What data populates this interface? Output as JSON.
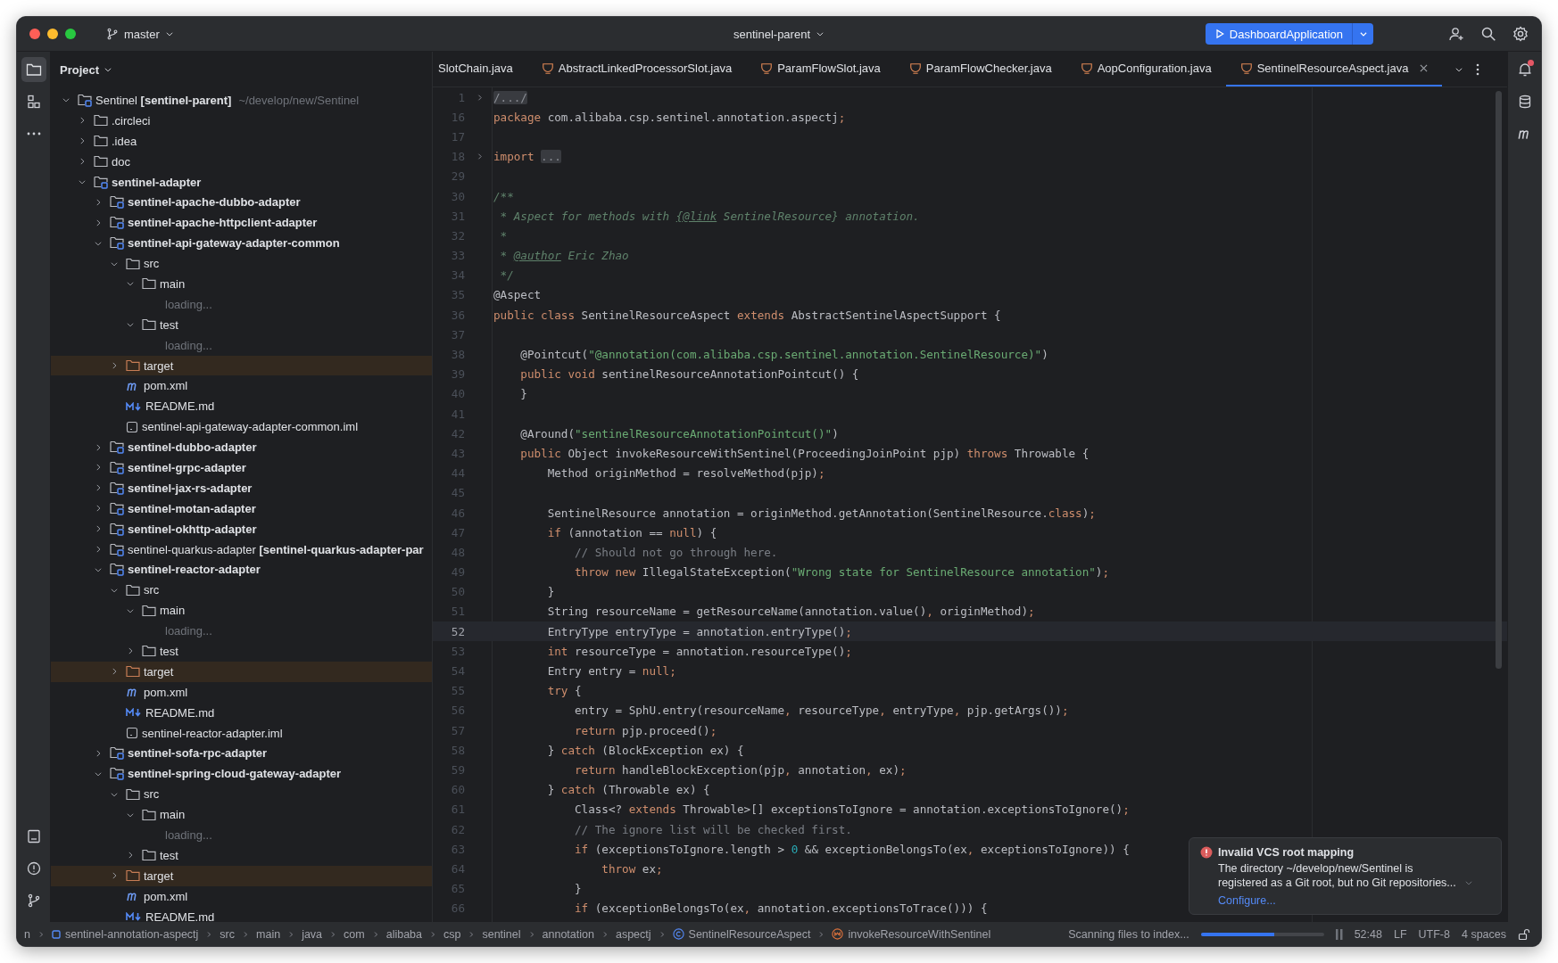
{
  "titlebar": {
    "branch": "master",
    "project": "sentinel-parent",
    "run_config": "DashboardApplication"
  },
  "project": {
    "title": "Project",
    "tree": [
      {
        "name": "Sentinel **[sentinel-parent]**",
        "path": "~/develop/new/Sentinel",
        "kind": "module",
        "expanded": true,
        "children": [
          {
            "name": ".circleci",
            "kind": "folder",
            "expanded": false
          },
          {
            "name": ".idea",
            "kind": "folder",
            "expanded": false
          },
          {
            "name": "doc",
            "kind": "folder",
            "expanded": false
          },
          {
            "name": "sentinel-adapter",
            "kind": "module",
            "bold": true,
            "expanded": true,
            "children": [
              {
                "name": "sentinel-apache-dubbo-adapter",
                "kind": "module",
                "bold": true,
                "expanded": false
              },
              {
                "name": "sentinel-apache-httpclient-adapter",
                "kind": "module",
                "bold": true,
                "expanded": false
              },
              {
                "name": "sentinel-api-gateway-adapter-common",
                "kind": "module",
                "bold": true,
                "expanded": true,
                "children": [
                  {
                    "name": "src",
                    "kind": "folder",
                    "expanded": true,
                    "children": [
                      {
                        "name": "main",
                        "kind": "folder",
                        "expanded": true,
                        "children": [
                          {
                            "name": "loading...",
                            "kind": "loading"
                          }
                        ]
                      },
                      {
                        "name": "test",
                        "kind": "folder",
                        "expanded": true,
                        "children": [
                          {
                            "name": "loading...",
                            "kind": "loading"
                          }
                        ]
                      }
                    ]
                  },
                  {
                    "name": "target",
                    "kind": "excluded",
                    "expanded": false
                  },
                  {
                    "name": "pom.xml",
                    "kind": "maven"
                  },
                  {
                    "name": "README.md",
                    "kind": "markdown"
                  },
                  {
                    "name": "sentinel-api-gateway-adapter-common.iml",
                    "kind": "iml"
                  }
                ]
              },
              {
                "name": "sentinel-dubbo-adapter",
                "kind": "module",
                "bold": true,
                "expanded": false
              },
              {
                "name": "sentinel-grpc-adapter",
                "kind": "module",
                "bold": true,
                "expanded": false
              },
              {
                "name": "sentinel-jax-rs-adapter",
                "kind": "module",
                "bold": true,
                "expanded": false
              },
              {
                "name": "sentinel-motan-adapter",
                "kind": "module",
                "bold": true,
                "expanded": false
              },
              {
                "name": "sentinel-okhttp-adapter",
                "kind": "module",
                "bold": true,
                "expanded": false
              },
              {
                "name": "sentinel-quarkus-adapter **[sentinel-quarkus-adapter-par**",
                "kind": "module",
                "expanded": false
              },
              {
                "name": "sentinel-reactor-adapter",
                "kind": "module",
                "bold": true,
                "expanded": true,
                "children": [
                  {
                    "name": "src",
                    "kind": "folder",
                    "expanded": true,
                    "children": [
                      {
                        "name": "main",
                        "kind": "folder",
                        "expanded": true,
                        "children": [
                          {
                            "name": "loading...",
                            "kind": "loading"
                          }
                        ]
                      },
                      {
                        "name": "test",
                        "kind": "folder",
                        "expanded": false
                      }
                    ]
                  },
                  {
                    "name": "target",
                    "kind": "excluded",
                    "expanded": false
                  },
                  {
                    "name": "pom.xml",
                    "kind": "maven"
                  },
                  {
                    "name": "README.md",
                    "kind": "markdown"
                  },
                  {
                    "name": "sentinel-reactor-adapter.iml",
                    "kind": "iml"
                  }
                ]
              },
              {
                "name": "sentinel-sofa-rpc-adapter",
                "kind": "module",
                "bold": true,
                "expanded": false
              },
              {
                "name": "sentinel-spring-cloud-gateway-adapter",
                "kind": "module",
                "bold": true,
                "expanded": true,
                "children": [
                  {
                    "name": "src",
                    "kind": "folder",
                    "expanded": true,
                    "children": [
                      {
                        "name": "main",
                        "kind": "folder",
                        "expanded": true,
                        "children": [
                          {
                            "name": "loading...",
                            "kind": "loading"
                          }
                        ]
                      },
                      {
                        "name": "test",
                        "kind": "folder",
                        "expanded": false
                      }
                    ]
                  },
                  {
                    "name": "target",
                    "kind": "excluded",
                    "expanded": false
                  },
                  {
                    "name": "pom.xml",
                    "kind": "maven"
                  },
                  {
                    "name": "README.md",
                    "kind": "markdown"
                  }
                ]
              }
            ]
          }
        ]
      }
    ]
  },
  "tabs": [
    {
      "label": "SlotChain.java",
      "kind": "plain",
      "selected": false
    },
    {
      "label": "AbstractLinkedProcessorSlot.java",
      "kind": "java",
      "selected": false
    },
    {
      "label": "ParamFlowSlot.java",
      "kind": "java",
      "selected": false
    },
    {
      "label": "ParamFlowChecker.java",
      "kind": "java",
      "selected": false
    },
    {
      "label": "AopConfiguration.java",
      "kind": "java",
      "selected": false
    },
    {
      "label": "SentinelResourceAspect.java",
      "kind": "java",
      "selected": true
    }
  ],
  "editor": {
    "lines": [
      {
        "no": "1",
        "folded": true,
        "tokens": [
          {
            "text": "/.../",
            "kind": "folded"
          }
        ]
      },
      {
        "no": "16",
        "tokens": [
          {
            "text": "package",
            "kind": "keyword"
          },
          {
            "text": " com.alibaba.csp.sentinel.annotation.aspectj",
            "kind": "plain"
          },
          {
            "text": ";",
            "kind": "keyword"
          }
        ]
      },
      {
        "no": "17"
      },
      {
        "no": "18",
        "folded": true,
        "tokens": [
          {
            "text": "import ",
            "kind": "keyword"
          },
          {
            "text": "...",
            "kind": "folded"
          }
        ]
      },
      {
        "no": "29"
      },
      {
        "no": "30",
        "tokens": [
          {
            "text": "/**",
            "kind": "doc"
          }
        ]
      },
      {
        "no": "31",
        "tokens": [
          {
            "text": " * Aspect for methods with ",
            "kind": "doc"
          },
          {
            "text": "{@link",
            "kind": "doctag"
          },
          {
            "text": " SentinelResource} annotation.",
            "kind": "doc"
          }
        ]
      },
      {
        "no": "32",
        "tokens": [
          {
            "text": " *",
            "kind": "doc"
          }
        ]
      },
      {
        "no": "33",
        "tokens": [
          {
            "text": " * ",
            "kind": "doc"
          },
          {
            "text": "@author",
            "kind": "doctag"
          },
          {
            "text": " Eric Zhao",
            "kind": "doc"
          }
        ]
      },
      {
        "no": "34",
        "tokens": [
          {
            "text": " */",
            "kind": "doc"
          }
        ]
      },
      {
        "no": "35",
        "tokens": [
          {
            "text": "@Aspect",
            "kind": "plain"
          }
        ]
      },
      {
        "no": "36",
        "tokens": [
          {
            "text": "public class",
            "kind": "keyword"
          },
          {
            "text": " SentinelResourceAspect ",
            "kind": "plain"
          },
          {
            "text": "extends",
            "kind": "keyword"
          },
          {
            "text": " AbstractSentinelAspectSupport {",
            "kind": "plain"
          }
        ]
      },
      {
        "no": "37"
      },
      {
        "no": "38",
        "tokens": [
          {
            "text": "    @Pointcut(",
            "kind": "plain"
          },
          {
            "text": "\"@annotation(com.alibaba.csp.sentinel.annotation.SentinelResource)\"",
            "kind": "string"
          },
          {
            "text": ")",
            "kind": "plain"
          }
        ]
      },
      {
        "no": "39",
        "tokens": [
          {
            "text": "    public void",
            "kind": "keyword"
          },
          {
            "text": " sentinelResourceAnnotationPointcut() {",
            "kind": "plain"
          }
        ]
      },
      {
        "no": "40",
        "tokens": [
          {
            "text": "    }",
            "kind": "plain"
          }
        ]
      },
      {
        "no": "41"
      },
      {
        "no": "42",
        "tokens": [
          {
            "text": "    @Around(",
            "kind": "plain"
          },
          {
            "text": "\"sentinelResourceAnnotationPointcut()\"",
            "kind": "string"
          },
          {
            "text": ")",
            "kind": "plain"
          }
        ]
      },
      {
        "no": "43",
        "tokens": [
          {
            "text": "    public",
            "kind": "keyword"
          },
          {
            "text": " Object invokeResourceWithSentinel(ProceedingJoinPoint pjp) ",
            "kind": "plain"
          },
          {
            "text": "throws",
            "kind": "keyword"
          },
          {
            "text": " Throwable {",
            "kind": "plain"
          }
        ]
      },
      {
        "no": "44",
        "tokens": [
          {
            "text": "        Method originMethod = resolveMethod(pjp)",
            "kind": "plain"
          },
          {
            "text": ";",
            "kind": "keyword"
          }
        ]
      },
      {
        "no": "45"
      },
      {
        "no": "46",
        "tokens": [
          {
            "text": "        SentinelResource annotation = originMethod.getAnnotation(SentinelResource.",
            "kind": "plain"
          },
          {
            "text": "class",
            "kind": "keyword"
          },
          {
            "text": ")",
            "kind": "plain"
          },
          {
            "text": ";",
            "kind": "keyword"
          }
        ]
      },
      {
        "no": "47",
        "tokens": [
          {
            "text": "        if",
            "kind": "keyword"
          },
          {
            "text": " (annotation == ",
            "kind": "plain"
          },
          {
            "text": "null",
            "kind": "keyword"
          },
          {
            "text": ") {",
            "kind": "plain"
          }
        ]
      },
      {
        "no": "48",
        "tokens": [
          {
            "text": "            // Should not go through here.",
            "kind": "comment"
          }
        ]
      },
      {
        "no": "49",
        "tokens": [
          {
            "text": "            throw new",
            "kind": "keyword"
          },
          {
            "text": " IllegalStateException(",
            "kind": "plain"
          },
          {
            "text": "\"Wrong state for SentinelResource annotation\"",
            "kind": "string"
          },
          {
            "text": ")",
            "kind": "plain"
          },
          {
            "text": ";",
            "kind": "keyword"
          }
        ]
      },
      {
        "no": "50",
        "tokens": [
          {
            "text": "        }",
            "kind": "plain"
          }
        ]
      },
      {
        "no": "51",
        "tokens": [
          {
            "text": "        String resourceName = getResourceName(annotation.value()",
            "kind": "plain"
          },
          {
            "text": ",",
            "kind": "keyword"
          },
          {
            "text": " originMethod)",
            "kind": "plain"
          },
          {
            "text": ";",
            "kind": "keyword"
          }
        ]
      },
      {
        "no": "52",
        "current": true,
        "tokens": [
          {
            "text": "        EntryType entryType = annotation.entryType()",
            "kind": "plain"
          },
          {
            "text": ";",
            "kind": "keyword"
          }
        ]
      },
      {
        "no": "53",
        "tokens": [
          {
            "text": "        int",
            "kind": "keyword"
          },
          {
            "text": " resourceType = annotation.resourceType()",
            "kind": "plain"
          },
          {
            "text": ";",
            "kind": "keyword"
          }
        ]
      },
      {
        "no": "54",
        "tokens": [
          {
            "text": "        Entry entry = ",
            "kind": "plain"
          },
          {
            "text": "null;",
            "kind": "keyword"
          }
        ]
      },
      {
        "no": "55",
        "tokens": [
          {
            "text": "        try",
            "kind": "keyword"
          },
          {
            "text": " {",
            "kind": "plain"
          }
        ]
      },
      {
        "no": "56",
        "tokens": [
          {
            "text": "            entry = SphU.entry(resourceName",
            "kind": "plain"
          },
          {
            "text": ",",
            "kind": "keyword"
          },
          {
            "text": " resourceType",
            "kind": "plain"
          },
          {
            "text": ",",
            "kind": "keyword"
          },
          {
            "text": " entryType",
            "kind": "plain"
          },
          {
            "text": ",",
            "kind": "keyword"
          },
          {
            "text": " pjp.getArgs())",
            "kind": "plain"
          },
          {
            "text": ";",
            "kind": "keyword"
          }
        ]
      },
      {
        "no": "57",
        "tokens": [
          {
            "text": "            return",
            "kind": "keyword"
          },
          {
            "text": " pjp.proceed()",
            "kind": "plain"
          },
          {
            "text": ";",
            "kind": "keyword"
          }
        ]
      },
      {
        "no": "58",
        "tokens": [
          {
            "text": "        } ",
            "kind": "plain"
          },
          {
            "text": "catch",
            "kind": "keyword"
          },
          {
            "text": " (BlockException ex) {",
            "kind": "plain"
          }
        ]
      },
      {
        "no": "59",
        "tokens": [
          {
            "text": "            return",
            "kind": "keyword"
          },
          {
            "text": " handleBlockException(pjp",
            "kind": "plain"
          },
          {
            "text": ",",
            "kind": "keyword"
          },
          {
            "text": " annotation",
            "kind": "plain"
          },
          {
            "text": ",",
            "kind": "keyword"
          },
          {
            "text": " ex)",
            "kind": "plain"
          },
          {
            "text": ";",
            "kind": "keyword"
          }
        ]
      },
      {
        "no": "60",
        "tokens": [
          {
            "text": "        } ",
            "kind": "plain"
          },
          {
            "text": "catch",
            "kind": "keyword"
          },
          {
            "text": " (Throwable ex) {",
            "kind": "plain"
          }
        ]
      },
      {
        "no": "61",
        "tokens": [
          {
            "text": "            Class<? ",
            "kind": "plain"
          },
          {
            "text": "extends",
            "kind": "keyword"
          },
          {
            "text": " Throwable>[] exceptionsToIgnore = annotation.exceptionsToIgnore()",
            "kind": "plain"
          },
          {
            "text": ";",
            "kind": "keyword"
          }
        ]
      },
      {
        "no": "62",
        "tokens": [
          {
            "text": "            // The ignore list will be checked first.",
            "kind": "comment"
          }
        ]
      },
      {
        "no": "63",
        "tokens": [
          {
            "text": "            if",
            "kind": "keyword"
          },
          {
            "text": " (exceptionsToIgnore.length > ",
            "kind": "plain"
          },
          {
            "text": "0",
            "kind": "number"
          },
          {
            "text": " && exceptionBelongsTo(ex",
            "kind": "plain"
          },
          {
            "text": ",",
            "kind": "keyword"
          },
          {
            "text": " exceptionsToIgnore)) {",
            "kind": "plain"
          }
        ]
      },
      {
        "no": "64",
        "tokens": [
          {
            "text": "                throw",
            "kind": "keyword"
          },
          {
            "text": " ex",
            "kind": "plain"
          },
          {
            "text": ";",
            "kind": "keyword"
          }
        ]
      },
      {
        "no": "65",
        "tokens": [
          {
            "text": "            }",
            "kind": "plain"
          }
        ]
      },
      {
        "no": "66",
        "tokens": [
          {
            "text": "            if",
            "kind": "keyword"
          },
          {
            "text": " (exceptionBelongsTo(ex",
            "kind": "plain"
          },
          {
            "text": ",",
            "kind": "keyword"
          },
          {
            "text": " annotation.exceptionsToTrace())) {",
            "kind": "plain"
          }
        ]
      }
    ]
  },
  "notification": {
    "title": "Invalid VCS root mapping",
    "body": "The directory ~/develop/new/Sentinel is registered as a Git root, but no Git repositories...",
    "action": "Configure..."
  },
  "status_bar": {
    "breadcrumbs": [
      {
        "text": "n",
        "kind": "plain"
      },
      {
        "text": "sentinel-annotation-aspectj",
        "kind": "module"
      },
      {
        "text": "src",
        "kind": "plain"
      },
      {
        "text": "main",
        "kind": "plain"
      },
      {
        "text": "java",
        "kind": "plain"
      },
      {
        "text": "com",
        "kind": "plain"
      },
      {
        "text": "alibaba",
        "kind": "plain"
      },
      {
        "text": "csp",
        "kind": "plain"
      },
      {
        "text": "sentinel",
        "kind": "plain"
      },
      {
        "text": "annotation",
        "kind": "plain"
      },
      {
        "text": "aspectj",
        "kind": "plain"
      },
      {
        "text": "SentinelResourceAspect",
        "kind": "class"
      },
      {
        "text": "invokeResourceWithSentinel",
        "kind": "method"
      }
    ],
    "task": "Scanning files to index...",
    "progress": {
      "level": 0.6
    },
    "items": [
      "52:48",
      "LF",
      "UTF-8",
      "4 spaces"
    ]
  }
}
